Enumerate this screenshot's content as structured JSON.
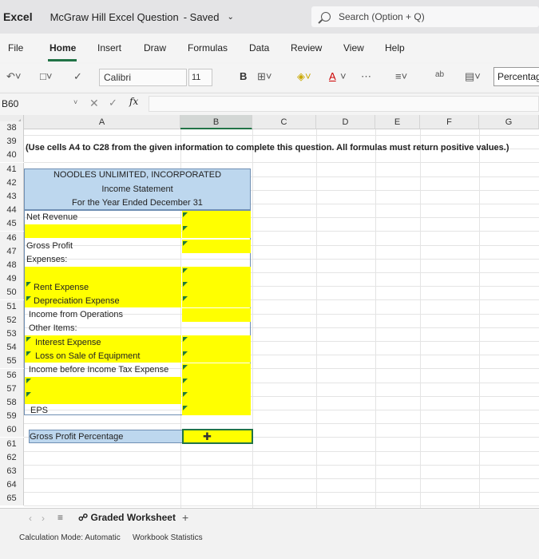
{
  "app": {
    "name": "Excel",
    "doc_title": "McGraw Hill Excel Question",
    "status": "Saved",
    "search_placeholder": "Search (Option + Q)"
  },
  "menu": [
    "File",
    "Home",
    "Insert",
    "Draw",
    "Formulas",
    "Data",
    "Review",
    "View",
    "Help"
  ],
  "toolbar": {
    "font": "Calibri",
    "font_size": "11",
    "bold": "B",
    "number_format": "Percentage",
    "font_color_label": "A"
  },
  "formula_bar": {
    "name_box": "B60",
    "fx": "fx",
    "value": ""
  },
  "columns": [
    "A",
    "B",
    "C",
    "D",
    "E",
    "F",
    "G"
  ],
  "rows": [
    "38",
    "39",
    "40",
    "41",
    "42",
    "43",
    "44",
    "45",
    "46",
    "47",
    "48",
    "49",
    "50",
    "51",
    "52",
    "53",
    "54",
    "55",
    "56",
    "57",
    "58",
    "59",
    "60",
    "61",
    "62",
    "63",
    "64",
    "65"
  ],
  "instruction": "(Use cells A4 to C28 from the given information to complete this question. All formulas must return positive values.)",
  "statement": {
    "company": "NOODLES UNLIMITED, INCORPORATED",
    "title": "Income Statement",
    "period": "For the Year Ended December 31",
    "lines": {
      "net_revenue": "Net Revenue",
      "gross_profit": "Gross Profit",
      "expenses": "Expenses:",
      "rent": "Rent Expense",
      "depreciation": "Depreciation Expense",
      "income_ops": "Income from Operations",
      "other_items": "Other Items:",
      "interest": "Interest Expense",
      "loss_sale": "Loss on Sale of Equipment",
      "income_before_tax": "Income before Income Tax Expense",
      "eps": "EPS",
      "gpp": "Gross Profit Percentage"
    }
  },
  "sheet_tab": "Graded Worksheet",
  "status": {
    "calc_mode": "Calculation Mode: Automatic",
    "stats": "Workbook Statistics"
  },
  "colors": {
    "accent": "#217346",
    "header_fill": "#bdd7ee",
    "input_fill": "#ffff00"
  }
}
